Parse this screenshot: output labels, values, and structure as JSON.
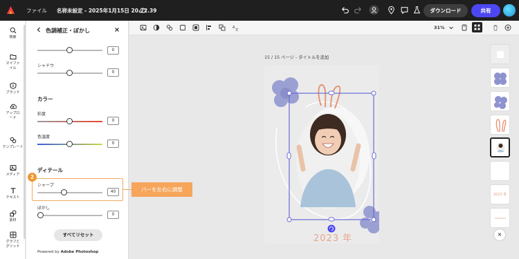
{
  "topbar": {
    "file_label": "ファイル",
    "doc_title": "名称未設定 - 2025年1月15日 20.22.39",
    "download_label": "ダウンロード",
    "share_label": "共有"
  },
  "rail": {
    "items": [
      {
        "label": "検索",
        "icon": "search-icon"
      },
      {
        "label": "マイファイル",
        "icon": "folder-icon"
      },
      {
        "label": "ブランド",
        "icon": "brand-icon"
      },
      {
        "label": "アップロード",
        "icon": "upload-icon"
      },
      {
        "label": "テンプレート",
        "icon": "template-icon"
      },
      {
        "label": "メディア",
        "icon": "media-icon"
      },
      {
        "label": "テキスト",
        "icon": "text-icon"
      },
      {
        "label": "素材",
        "icon": "elements-icon"
      },
      {
        "label": "グラフとグリッド",
        "icon": "grid-icon"
      }
    ]
  },
  "panel": {
    "title": "色調補正・ぼかし",
    "top_slider_value": "0",
    "shadow": {
      "label": "シャドウ",
      "value": "0"
    },
    "color_section": "カラー",
    "saturation": {
      "label": "彩度",
      "value": "0"
    },
    "temperature": {
      "label": "色温度",
      "value": "0"
    },
    "detail_section": "ディテール",
    "sharpen": {
      "label": "シャープ",
      "value": "40"
    },
    "blur": {
      "label": "ぼかし",
      "value": "0"
    },
    "reset_label": "すべてリセット",
    "powered_prefix": "Powered by",
    "powered_brand": "Adobe Photoshop"
  },
  "annotation": {
    "step": "2",
    "callout": "バーを左右に調整"
  },
  "canvas": {
    "zoom": "31%",
    "page_label": "15 / 15 ページ - タイトルを追加",
    "year_text": "2023 年"
  },
  "thumbnails": {
    "year_text": "2023 年",
    "close_label": "×"
  },
  "colors": {
    "accent": "#4d47f2",
    "callout": "#f6a55a",
    "selection": "#6a6ad8"
  }
}
